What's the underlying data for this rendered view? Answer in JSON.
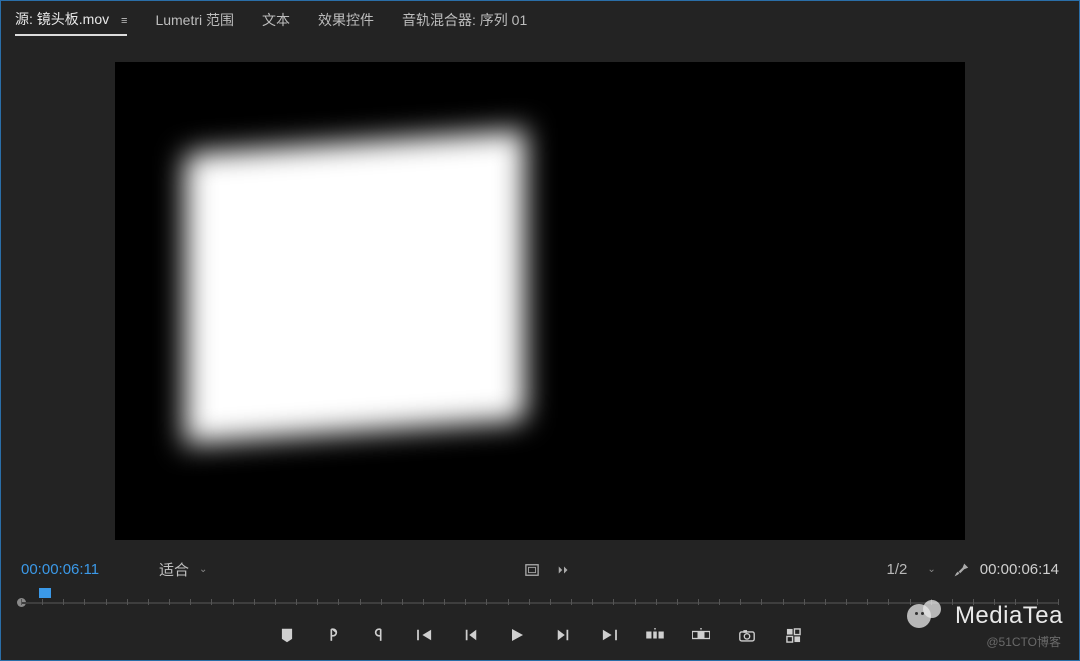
{
  "tabs": {
    "source": {
      "label": "源: 镜头板.mov"
    },
    "lumetri": {
      "label": "Lumetri 范围"
    },
    "text": {
      "label": "文本"
    },
    "effects": {
      "label": "效果控件"
    },
    "audiomixer": {
      "label": "音轨混合器: 序列 01"
    }
  },
  "timecode": {
    "current": "00:00:06:11",
    "total": "00:00:06:14"
  },
  "zoom": {
    "label": "适合"
  },
  "resolution": {
    "label": "1/2"
  },
  "icons": {
    "menu": "≡",
    "chevron": "⌄",
    "wrench": "wrench-icon",
    "safe_margin": "safe-margin-icon",
    "twin_arrow": "twin-arrow-icon"
  },
  "transport": {
    "marker": "add-marker",
    "in": "mark-in",
    "out": "mark-out",
    "goto_in": "go-to-in",
    "step_back": "step-back",
    "play": "play",
    "step_fwd": "step-forward",
    "goto_out": "go-to-out",
    "insert": "insert",
    "overwrite": "overwrite",
    "export_frame": "export-frame",
    "button_editor": "button-editor"
  },
  "watermark": {
    "text": "MediaTea"
  },
  "credit": "@51CTO博客"
}
